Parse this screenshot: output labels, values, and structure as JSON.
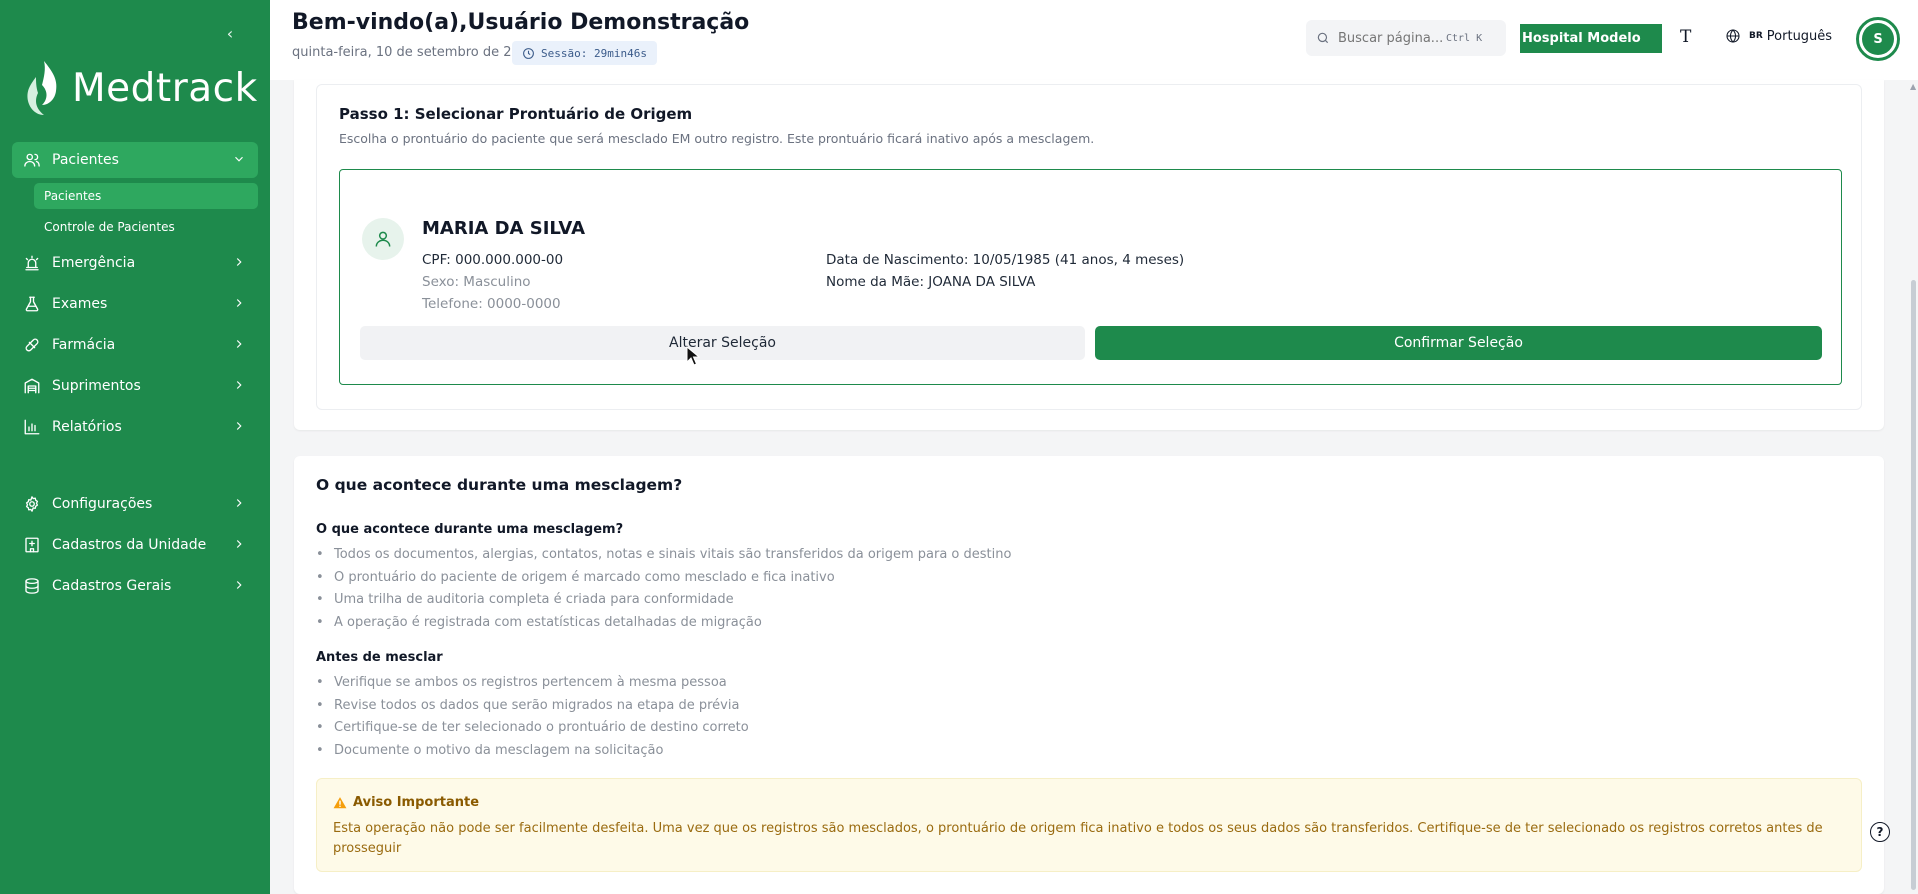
{
  "app": {
    "brand": "Medtrack",
    "accent": "#1e8a4c"
  },
  "sidebar": {
    "items": [
      {
        "label": "Pacientes",
        "icon": "users-icon",
        "active": true,
        "expanded": true,
        "children": [
          {
            "label": "Pacientes",
            "active": true
          },
          {
            "label": "Controle de Pacientes"
          }
        ]
      },
      {
        "label": "Emergência",
        "icon": "siren-icon"
      },
      {
        "label": "Exames",
        "icon": "flask-icon"
      },
      {
        "label": "Farmácia",
        "icon": "pill-icon"
      },
      {
        "label": "Suprimentos",
        "icon": "warehouse-icon"
      },
      {
        "label": "Relatórios",
        "icon": "bar-chart-icon"
      },
      {
        "label": "Configurações",
        "icon": "gear-icon"
      },
      {
        "label": "Cadastros da Unidade",
        "icon": "hospital-icon"
      },
      {
        "label": "Cadastros Gerais",
        "icon": "database-icon"
      }
    ]
  },
  "header": {
    "welcome": "Bem-vindo(a),Usuário Demonstração",
    "date": "quinta-feira, 10 de setembro de 2026",
    "session": "Sessão: 29min46s",
    "search_placeholder": "Buscar página...",
    "search_shortcut": "Ctrl K",
    "hospital": "Hospital Modelo",
    "font_toggle": "T",
    "language_flag": "BR",
    "language": "Português",
    "avatar_initial": "S"
  },
  "step": {
    "title": "Passo 1: Selecionar Prontuário de Origem",
    "description": "Escolha o prontuário do paciente que será mesclado EM outro registro. Este prontuário ficará inativo após a mesclagem.",
    "patient": {
      "name": "MARIA DA SILVA",
      "cpf": "CPF: 000.000.000-00",
      "sexo": "Sexo: Masculino",
      "telefone": "Telefone: 0000-0000",
      "nascimento": "Data de Nascimento: 10/05/1985 (41 anos, 4 meses)",
      "mae": "Nome da Mãe: JOANA DA SILVA"
    },
    "alter_label": "Alterar Seleção",
    "confirm_label": "Confirmar Seleção"
  },
  "info": {
    "title": "O que acontece durante uma mesclagem?",
    "section1_title": "O que acontece durante uma mesclagem?",
    "section1_items": [
      "Todos os documentos, alergias, contatos, notas e sinais vitais são transferidos da origem para o destino",
      "O prontuário do paciente de origem é marcado como mesclado e fica inativo",
      "Uma trilha de auditoria completa é criada para conformidade",
      "A operação é registrada com estatísticas detalhadas de migração"
    ],
    "section2_title": "Antes de mesclar",
    "section2_items": [
      "Verifique se ambos os registros pertencem à mesma pessoa",
      "Revise todos os dados que serão migrados na etapa de prévia",
      "Certifique-se de ter selecionado o prontuário de destino correto",
      "Documente o motivo da mesclagem na solicitação"
    ],
    "warning_title": "Aviso Importante",
    "warning_text": "Esta operação não pode ser facilmente desfeita. Uma vez que os registros são mesclados, o prontuário de origem fica inativo e todos os seus dados são transferidos. Certifique-se de ter selecionado os registros corretos antes de prosseguir"
  },
  "help": "?"
}
